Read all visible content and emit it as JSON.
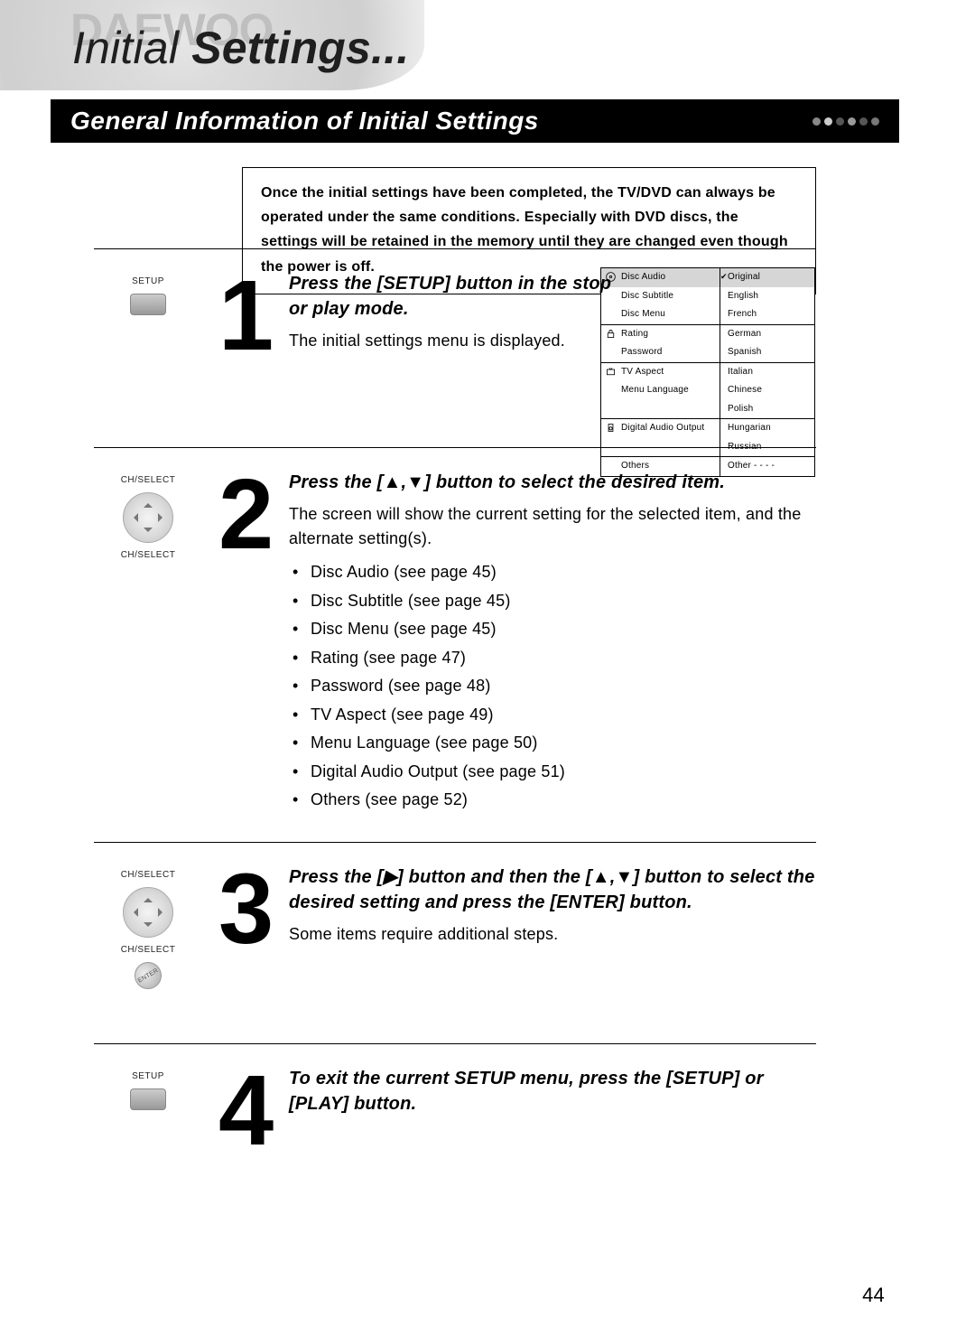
{
  "brand_wash": "DAEWOO",
  "page_title_prefix": "Initial ",
  "page_title_bold": "Settings...",
  "banner_title": "General Information of Initial Settings",
  "intro": "Once the initial settings have been completed, the TV/DVD can always be operated under the same conditions. Especially with DVD discs, the settings will be retained in the memory until they are changed even though the power is off.",
  "step1": {
    "label_setup": "SETUP",
    "num": "1",
    "heading": "Press the [SETUP] button in the stop or play mode.",
    "body": "The initial settings menu is displayed."
  },
  "step2": {
    "label_top": "CH/SELECT",
    "label_bot": "CH/SELECT",
    "num": "2",
    "heading": "Press the [▲,▼] button to select the desired item.",
    "body": "The screen will show the current setting for the selected item, and the alternate setting(s).",
    "items": [
      "Disc Audio (see page 45)",
      "Disc Subtitle (see page 45)",
      "Disc Menu (see page 45)",
      "Rating (see page 47)",
      "Password (see page 48)",
      "TV Aspect (see page 49)",
      "Menu Language (see page 50)",
      "Digital Audio Output (see page 51)",
      "Others (see page 52)"
    ]
  },
  "step3": {
    "label_top": "CH/SELECT",
    "label_bot": "CH/SELECT",
    "label_enter": "ENTER",
    "num": "3",
    "heading": "Press the [▶] button and then the [▲,▼] button to select the desired setting and press the [ENTER] button.",
    "body": "Some items require additional steps."
  },
  "step4": {
    "label_setup": "SETUP",
    "num": "4",
    "heading": "To exit the current SETUP menu, press the [SETUP] or [PLAY] button."
  },
  "osd": {
    "left": [
      "Disc Audio",
      "Disc Subtitle",
      "Disc Menu",
      "Rating",
      "Password",
      "TV Aspect",
      "Menu Language",
      "Digital Audio  Output",
      "Others"
    ],
    "right": [
      "Original",
      "English",
      "French",
      "German",
      "Spanish",
      "Italian",
      "Chinese",
      "Polish",
      "Hungarian",
      "Russian",
      "Other - - - -"
    ],
    "checkmark": "✔"
  },
  "page_number": "44"
}
